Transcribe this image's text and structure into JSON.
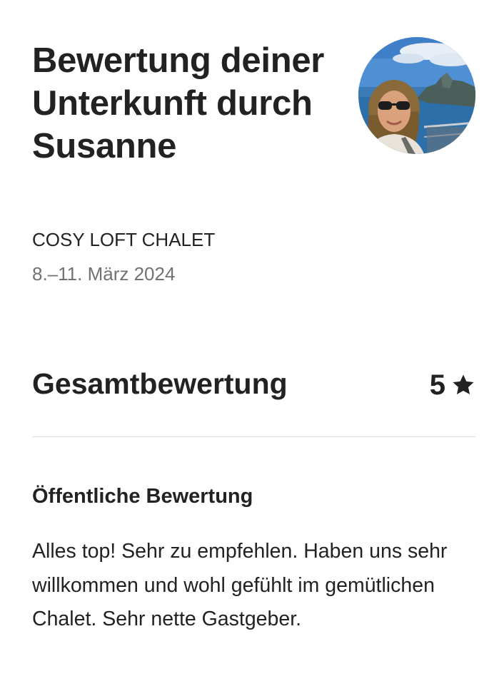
{
  "review": {
    "title": "Bewertung deiner Unterkunft durch Susanne",
    "listing_name": "COSY LOFT CHALET",
    "dates": "8.–11. März 2024"
  },
  "overall": {
    "label": "Gesamtbewertung",
    "value": "5",
    "icon": "star-icon"
  },
  "public_review": {
    "heading": "Öffentliche Bewertung",
    "text": "Alles top! Sehr zu empfehlen. Haben uns sehr willkommen und wohl gefühlt im gemütlichen Chalet. Sehr nette Gastgeber."
  },
  "colors": {
    "text_primary": "#222222",
    "text_secondary": "#717171",
    "divider": "#dddddd"
  }
}
